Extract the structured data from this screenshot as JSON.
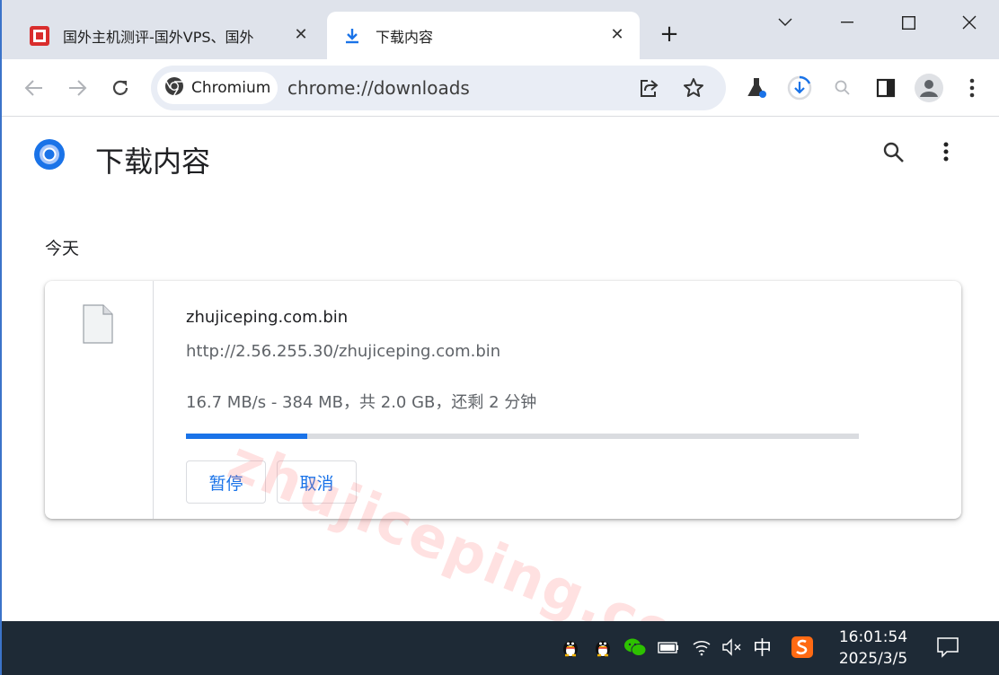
{
  "browser": {
    "tabs": [
      {
        "title": "国外主机测评-国外VPS、国外",
        "active": false,
        "icon": "site-favicon"
      },
      {
        "title": "下载内容",
        "active": true,
        "icon": "download-icon"
      }
    ],
    "new_tab_label": "+",
    "omnibox": {
      "chip_label": "Chromium",
      "url": "chrome://downloads"
    }
  },
  "page": {
    "title": "下载内容",
    "date_header": "今天",
    "download": {
      "filename": "zhujiceping.com.bin",
      "url": "http://2.56.255.30/zhujiceping.com.bin",
      "status": "16.7 MB/s - 384 MB，共 2.0 GB，还剩 2 分钟",
      "progress_fraction": 0.18,
      "pause_label": "暂停",
      "cancel_label": "取消"
    },
    "watermark": "zhujiceping.com"
  },
  "taskbar": {
    "ime_label": "中",
    "time": "16:01:54",
    "date": "2025/3/5"
  },
  "colors": {
    "accent": "#1a73e8",
    "tabstrip": "#dfe3eb",
    "taskbar": "#1e2a36"
  }
}
